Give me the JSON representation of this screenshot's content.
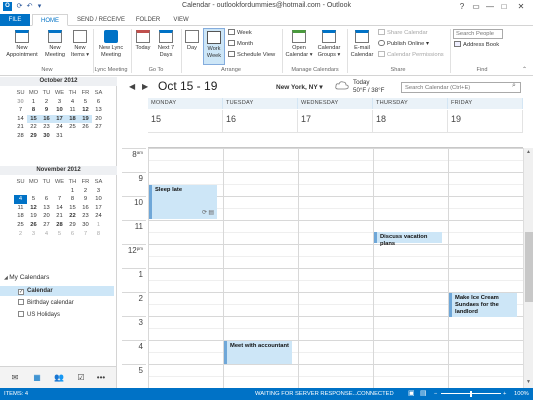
{
  "window": {
    "title": "Calendar - outlookfordummies@hotmail.com - Outlook",
    "controls": [
      "?",
      "▭",
      "—",
      "□",
      "✕"
    ]
  },
  "tabs": [
    "FILE",
    "HOME",
    "SEND / RECEIVE",
    "FOLDER",
    "VIEW"
  ],
  "ribbon": {
    "new": {
      "appointment": [
        "New",
        "Appointment"
      ],
      "meeting": [
        "New",
        "Meeting"
      ],
      "items": [
        "New",
        "Items ▾"
      ],
      "group": "New"
    },
    "lync": {
      "button": [
        "New Lync",
        "Meeting"
      ],
      "group": "Lync Meeting"
    },
    "goto": {
      "today": "Today",
      "next7": [
        "Next 7",
        "Days"
      ],
      "group": "Go To"
    },
    "arrange": {
      "day": "Day",
      "workweek": [
        "Work",
        "Week"
      ],
      "week": "Week",
      "month": "Month",
      "schedule": "Schedule View",
      "group": "Arrange"
    },
    "manage": {
      "open": [
        "Open",
        "Calendar ▾"
      ],
      "groups": [
        "Calendar",
        "Groups ▾"
      ],
      "group": "Manage Calendars"
    },
    "share": {
      "email": [
        "E-mail",
        "Calendar"
      ],
      "share_cal": "Share Calendar",
      "publish": "Publish Online ▾",
      "perms": "Calendar Permissions",
      "group": "Share"
    },
    "find": {
      "search_people_placeholder": "Search People",
      "address_book": "Address Book",
      "group": "Find"
    }
  },
  "mini_calendars": [
    {
      "title": "October 2012",
      "days": [
        "SU",
        "MO",
        "TU",
        "WE",
        "TH",
        "FR",
        "SA"
      ],
      "weeks": [
        [
          "30",
          "1",
          "2",
          "3",
          "4",
          "5",
          "6"
        ],
        [
          "7",
          "8",
          "9",
          "10",
          "11",
          "12",
          "13"
        ],
        [
          "14",
          "15",
          "16",
          "17",
          "18",
          "19",
          "20"
        ],
        [
          "21",
          "22",
          "23",
          "24",
          "25",
          "26",
          "27"
        ],
        [
          "28",
          "29",
          "30",
          "31",
          "",
          "",
          ""
        ]
      ]
    },
    {
      "title": "November 2012",
      "days": [
        "SU",
        "MO",
        "TU",
        "WE",
        "TH",
        "FR",
        "SA"
      ],
      "weeks": [
        [
          "",
          "",
          "",
          "",
          "1",
          "2",
          "3"
        ],
        [
          "4",
          "5",
          "6",
          "7",
          "8",
          "9",
          "10"
        ],
        [
          "11",
          "12",
          "13",
          "14",
          "15",
          "16",
          "17"
        ],
        [
          "18",
          "19",
          "20",
          "21",
          "22",
          "23",
          "24"
        ],
        [
          "25",
          "26",
          "27",
          "28",
          "29",
          "30",
          "1"
        ],
        [
          "2",
          "3",
          "4",
          "5",
          "6",
          "7",
          "8"
        ]
      ]
    }
  ],
  "my_calendars": {
    "header": "My Calendars",
    "items": [
      {
        "label": "Calendar",
        "checked": true
      },
      {
        "label": "Birthday calendar",
        "checked": false
      },
      {
        "label": "US Holidays",
        "checked": false
      }
    ]
  },
  "calendar_view": {
    "range": "Oct 15 - 19",
    "location": "New York, NY ▾",
    "weather_label": "Today",
    "weather_temp": "50°F / 38°F",
    "search_placeholder": "Search Calendar (Ctrl+E)",
    "day_names": [
      "MONDAY",
      "TUESDAY",
      "WEDNESDAY",
      "THURSDAY",
      "FRIDAY"
    ],
    "day_numbers": [
      "15",
      "16",
      "17",
      "18",
      "19"
    ],
    "hours": [
      {
        "h": "8",
        "ap": "am"
      },
      {
        "h": "9",
        "ap": ""
      },
      {
        "h": "10",
        "ap": ""
      },
      {
        "h": "11",
        "ap": ""
      },
      {
        "h": "12",
        "ap": "pm"
      },
      {
        "h": "1",
        "ap": ""
      },
      {
        "h": "2",
        "ap": ""
      },
      {
        "h": "3",
        "ap": ""
      },
      {
        "h": "4",
        "ap": ""
      },
      {
        "h": "5",
        "ap": ""
      }
    ],
    "events": [
      {
        "title": "Sleep late",
        "day": "MONDAY"
      },
      {
        "title": "Discuss vacation plans",
        "day": "THURSDAY"
      },
      {
        "title": "Make Ice Cream Sundaes for the landlord",
        "day": "FRIDAY"
      },
      {
        "title": "Meet with accountant",
        "day": "TUESDAY"
      }
    ]
  },
  "status_bar": {
    "items": "ITEMS: 4",
    "server": "WAITING FOR SERVER RESPONSE...",
    "connection": "CONNECTED",
    "zoom": "100%"
  },
  "colors": {
    "accent": "#0072c6",
    "event_bg": "#cde6f7",
    "event_border": "#6fa7d8"
  }
}
